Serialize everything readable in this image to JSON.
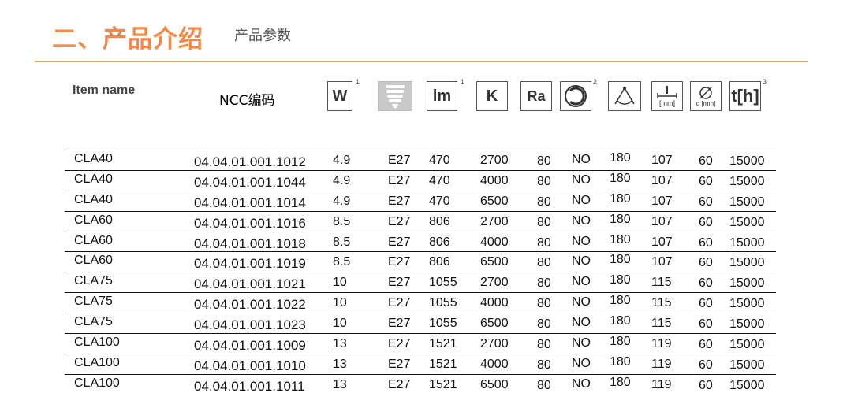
{
  "header": {
    "title": "二、产品介绍",
    "subtitle": "产品参数"
  },
  "table": {
    "col_item_name": "Item name",
    "col_ncc": "NCC编码",
    "icons": [
      {
        "name": "watt-icon",
        "text": "W",
        "sup": "1"
      },
      {
        "name": "bulb-base-icon",
        "text": "",
        "sup": ""
      },
      {
        "name": "lumen-icon",
        "text": "lm",
        "sup": "1"
      },
      {
        "name": "kelvin-icon",
        "text": "K",
        "sup": ""
      },
      {
        "name": "ra-icon",
        "text": "Ra",
        "sup": ""
      },
      {
        "name": "dimmable-icon",
        "text": "",
        "sup": "2"
      },
      {
        "name": "beam-angle-icon",
        "text": "",
        "sup": ""
      },
      {
        "name": "length-mm-icon",
        "text": "[mm]",
        "sup": ""
      },
      {
        "name": "diameter-mm-icon",
        "text": "d [mm]",
        "sup": ""
      },
      {
        "name": "lifetime-icon",
        "text": "t[h]",
        "sup": "3"
      }
    ],
    "rows": [
      {
        "name": "CLA40",
        "ncc": "04.04.01.001.1012",
        "w": "4.9",
        "base": "E27",
        "lm": "470",
        "k": "2700",
        "ra": "80",
        "dim": "NO",
        "angle": "180",
        "len": "107",
        "dia": "60",
        "life": "15000"
      },
      {
        "name": "CLA40",
        "ncc": "04.04.01.001.1044",
        "w": "4.9",
        "base": "E27",
        "lm": "470",
        "k": "4000",
        "ra": "80",
        "dim": "NO",
        "angle": "180",
        "len": "107",
        "dia": "60",
        "life": "15000"
      },
      {
        "name": "CLA40",
        "ncc": "04.04.01.001.1014",
        "w": "4.9",
        "base": "E27",
        "lm": "470",
        "k": "6500",
        "ra": "80",
        "dim": "NO",
        "angle": "180",
        "len": "107",
        "dia": "60",
        "life": "15000"
      },
      {
        "name": "CLA60",
        "ncc": "04.04.01.001.1016",
        "w": "8.5",
        "base": "E27",
        "lm": "806",
        "k": "2700",
        "ra": "80",
        "dim": "NO",
        "angle": "180",
        "len": "107",
        "dia": "60",
        "life": "15000"
      },
      {
        "name": "CLA60",
        "ncc": "04.04.01.001.1018",
        "w": "8.5",
        "base": "E27",
        "lm": "806",
        "k": "4000",
        "ra": "80",
        "dim": "NO",
        "angle": "180",
        "len": "107",
        "dia": "60",
        "life": "15000"
      },
      {
        "name": "CLA60",
        "ncc": "04.04.01.001.1019",
        "w": "8.5",
        "base": "E27",
        "lm": "806",
        "k": "6500",
        "ra": "80",
        "dim": "NO",
        "angle": "180",
        "len": "107",
        "dia": "60",
        "life": "15000"
      },
      {
        "name": "CLA75",
        "ncc": "04.04.01.001.1021",
        "w": "10",
        "base": "E27",
        "lm": "1055",
        "k": "2700",
        "ra": "80",
        "dim": "NO",
        "angle": "180",
        "len": "115",
        "dia": "60",
        "life": "15000"
      },
      {
        "name": "CLA75",
        "ncc": "04.04.01.001.1022",
        "w": "10",
        "base": "E27",
        "lm": "1055",
        "k": "4000",
        "ra": "80",
        "dim": "NO",
        "angle": "180",
        "len": "115",
        "dia": "60",
        "life": "15000"
      },
      {
        "name": "CLA75",
        "ncc": "04.04.01.001.1023",
        "w": "10",
        "base": "E27",
        "lm": "1055",
        "k": "6500",
        "ra": "80",
        "dim": "NO",
        "angle": "180",
        "len": "115",
        "dia": "60",
        "life": "15000"
      },
      {
        "name": "CLA100",
        "ncc": "04.04.01.001.1009",
        "w": "13",
        "base": "E27",
        "lm": "1521",
        "k": "2700",
        "ra": "80",
        "dim": "NO",
        "angle": "180",
        "len": "119",
        "dia": "60",
        "life": "15000"
      },
      {
        "name": "CLA100",
        "ncc": "04.04.01.001.1010",
        "w": "13",
        "base": "E27",
        "lm": "1521",
        "k": "4000",
        "ra": "80",
        "dim": "NO",
        "angle": "180",
        "len": "119",
        "dia": "60",
        "life": "15000"
      },
      {
        "name": "CLA100",
        "ncc": "04.04.01.001.1011",
        "w": "13",
        "base": "E27",
        "lm": "1521",
        "k": "6500",
        "ra": "80",
        "dim": "NO",
        "angle": "180",
        "len": "119",
        "dia": "60",
        "life": "15000"
      }
    ]
  }
}
